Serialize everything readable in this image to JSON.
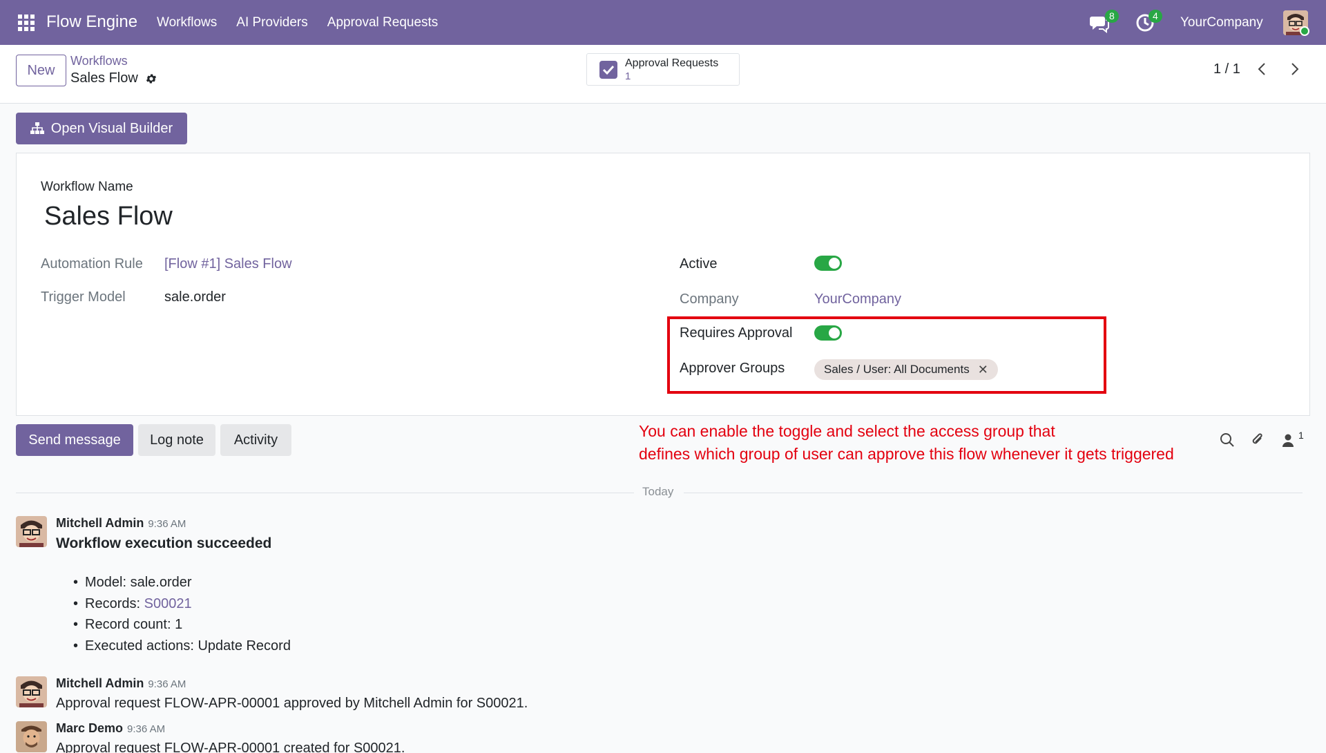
{
  "navbar": {
    "brand": "Flow Engine",
    "menu": [
      "Workflows",
      "AI Providers",
      "Approval Requests"
    ],
    "messages_badge": "8",
    "activities_badge": "4",
    "company": "YourCompany",
    "icons": [
      "apps-grid-icon",
      "chat-icon",
      "clock-icon",
      "user-avatar"
    ]
  },
  "control_panel": {
    "new_label": "New",
    "breadcrumb_parent": "Workflows",
    "breadcrumb_current": "Sales Flow",
    "smart_button_label": "Approval Requests",
    "smart_button_count": "1",
    "pager": "1 / 1"
  },
  "actions": {
    "open_visual_builder": "Open Visual Builder"
  },
  "form": {
    "title_label": "Workflow Name",
    "title": "Sales Flow",
    "automation_rule_label": "Automation Rule",
    "automation_rule_value": "[Flow #1] Sales Flow",
    "trigger_model_label": "Trigger Model",
    "trigger_model_value": "sale.order",
    "active_label": "Active",
    "active": true,
    "company_label": "Company",
    "company_value": "YourCompany",
    "requires_approval_label": "Requires Approval",
    "requires_approval": true,
    "approver_groups_label": "Approver Groups",
    "approver_groups": [
      "Sales / User: All Documents"
    ]
  },
  "annotation": {
    "line1": "You can enable the toggle and select the access group that",
    "line2": "defines which group of user can approve this flow whenever it gets triggered",
    "color": "#e3000f"
  },
  "chatter": {
    "send_message": "Send message",
    "log_note": "Log note",
    "activity": "Activity",
    "followers_count": "1",
    "date_separator": "Today",
    "messages": [
      {
        "author": "Mitchell Admin",
        "time": "9:36 AM",
        "title": "Workflow execution succeeded",
        "items": [
          {
            "text": "Model: sale.order"
          },
          {
            "label": "Records: ",
            "link": "S00021"
          },
          {
            "text": "Record count: 1"
          },
          {
            "text": "Executed actions: Update Record"
          }
        ]
      },
      {
        "author": "Mitchell Admin",
        "time": "9:36 AM",
        "body": "Approval request FLOW-APR-00001 approved by Mitchell Admin for S00021."
      },
      {
        "author": "Marc Demo",
        "time": "9:36 AM",
        "body": "Approval request FLOW-APR-00001 created for S00021."
      }
    ]
  },
  "colors": {
    "brand": "#71639e",
    "toggle_on": "#28a745",
    "badge": "#28a745",
    "highlight": "#e3000f"
  }
}
